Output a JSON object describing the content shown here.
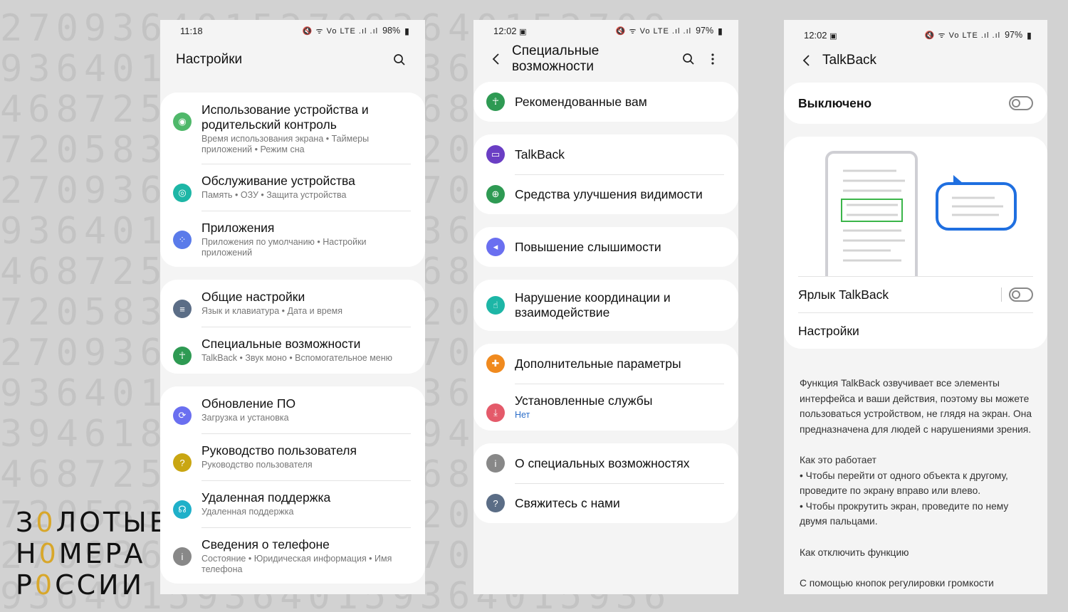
{
  "background_digits": [
    "270936401527093640152709",
    "936401593640159364015936",
    "468725346872534687253468",
    "720583972058397205839720",
    "270936427093642709364270",
    "936401593640159364015936",
    "468725346872534687253468",
    "720583972058397205839720",
    "270936427093642709364270",
    "936401593640159364015936",
    "394618739461873946187394",
    "468725346872534687253468",
    "720583972058397205839720",
    "270936427093642709364270",
    "936401593640159364015936"
  ],
  "logo": {
    "line1_a": "З",
    "line1_b": "0",
    "line1_c": "ЛОТЫЕ",
    "line2_a": "Н",
    "line2_b": "0",
    "line2_c": "МЕРА",
    "line3_a": "Р",
    "line3_b": "0",
    "line3_c": "ССИИ"
  },
  "phone1": {
    "status": {
      "time": "11:18",
      "icons": "🔇 ᯤ Vo LTE .ıl .ıl",
      "battery": "98%"
    },
    "title": "Настройки",
    "groups": [
      [
        {
          "title": "Использование устройства и родительский контроль",
          "subtitle": "Время использования экрана • Таймеры приложений • Режим сна",
          "color": "#4fb86a",
          "icon": "wellbeing-icon",
          "glyph": "◉"
        },
        {
          "title": "Обслуживание устройства",
          "subtitle": "Память • ОЗУ • Защита устройства",
          "color": "#1db6a6",
          "icon": "device-care-icon",
          "glyph": "◎"
        },
        {
          "title": "Приложения",
          "subtitle": "Приложения по умолчанию • Настройки приложений",
          "color": "#5a7bea",
          "icon": "apps-icon",
          "glyph": "⁘"
        }
      ],
      [
        {
          "title": "Общие настройки",
          "subtitle": "Язык и клавиатура • Дата и время",
          "color": "#5b6d86",
          "icon": "general-settings-icon",
          "glyph": "≡"
        },
        {
          "title": "Специальные возможности",
          "subtitle": "TalkBack • Звук моно • Вспомогательное меню",
          "color": "#2e9a53",
          "icon": "accessibility-icon",
          "glyph": "☥"
        }
      ],
      [
        {
          "title": "Обновление ПО",
          "subtitle": "Загрузка и установка",
          "color": "#6a6ff0",
          "icon": "software-update-icon",
          "glyph": "⟳"
        },
        {
          "title": "Руководство пользователя",
          "subtitle": "Руководство пользователя",
          "color": "#c9a612",
          "icon": "user-manual-icon",
          "glyph": "?"
        },
        {
          "title": "Удаленная поддержка",
          "subtitle": "Удаленная поддержка",
          "color": "#1fb0c9",
          "icon": "remote-support-icon",
          "glyph": "☊"
        },
        {
          "title": "Сведения о телефоне",
          "subtitle": "Состояние • Юридическая информация • Имя телефона",
          "color": "#888888",
          "icon": "about-phone-icon",
          "glyph": "i"
        }
      ]
    ]
  },
  "phone2": {
    "status": {
      "time": "12:02",
      "icons": "🔇 ᯤ Vo LTE .ıl .ıl",
      "battery": "97%"
    },
    "title": "Специальные возможности",
    "groups": [
      [
        {
          "title": "Рекомендованные вам",
          "color": "#2e9a53",
          "icon": "recommended-icon",
          "glyph": "☥"
        }
      ],
      [
        {
          "title": "TalkBack",
          "color": "#6a3ec4",
          "icon": "talkback-icon",
          "glyph": "▭"
        },
        {
          "title": "Средства улучшения видимости",
          "color": "#2e9a53",
          "icon": "visibility-icon",
          "glyph": "⊕"
        }
      ],
      [
        {
          "title": "Повышение слышимости",
          "color": "#6a6ff0",
          "icon": "hearing-icon",
          "glyph": "◂"
        }
      ],
      [
        {
          "title": "Нарушение координации и взаимодействие",
          "color": "#1db6a6",
          "icon": "interaction-icon",
          "glyph": "☝"
        }
      ],
      [
        {
          "title": "Дополнительные параметры",
          "color": "#f08a1e",
          "icon": "advanced-settings-icon",
          "glyph": "✚"
        },
        {
          "title": "Установленные службы",
          "subtitle": "Нет",
          "color": "#e45a6a",
          "icon": "installed-services-icon",
          "glyph": "⤓"
        }
      ],
      [
        {
          "title": "О специальных возможностях",
          "color": "#888888",
          "icon": "about-icon",
          "glyph": "i"
        },
        {
          "title": "Свяжитесь с нами",
          "color": "#5b6d86",
          "icon": "contact-icon",
          "glyph": "?"
        }
      ]
    ]
  },
  "phone3": {
    "status": {
      "time": "12:02",
      "icons": "🔇 ᯤ Vo LTE .ıl .ıl",
      "battery": "97%"
    },
    "title": "TalkBack",
    "switch_label": "Выключено",
    "shortcut_label": "Ярлык TalkBack",
    "settings_label": "Настройки",
    "description": [
      "Функция TalkBack озвучивает все элементы интерфейса и ваши действия, поэтому вы можете пользоваться устройством, не глядя на экран. Она предназначена для людей с нарушениями зрения.",
      "Как это работает\n• Чтобы перейти от одного объекта к другому, проведите по экрану вправо или влево.\n• Чтобы прокрутить экран, проведите по нему двумя пальцами.",
      "Как отключить функцию",
      "С помощью кнопок регулировки громкости"
    ]
  }
}
